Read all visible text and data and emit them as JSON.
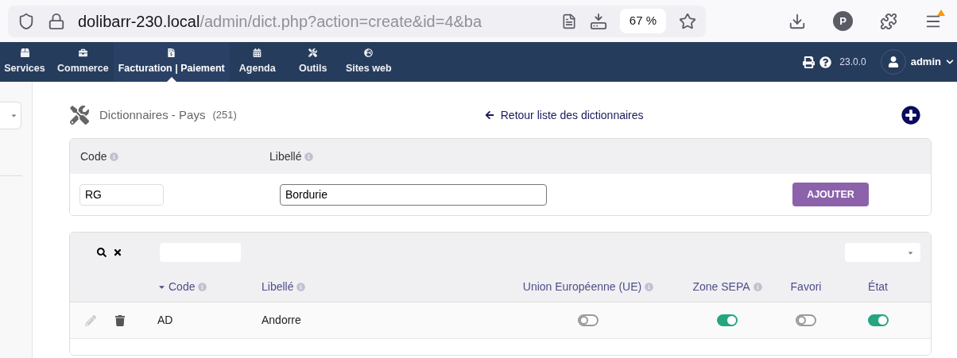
{
  "browser": {
    "url_host": "dolibarr-230.local",
    "url_path": "/admin/dict.php?action=create&id=4&ba",
    "zoom": "67 %",
    "profile": "P"
  },
  "top_menu": {
    "items": [
      {
        "label": "Services",
        "selected": false
      },
      {
        "label": "Commerce",
        "selected": false
      },
      {
        "label": "Facturation | Paiement",
        "selected": true
      },
      {
        "label": "Agenda",
        "selected": false
      },
      {
        "label": "Outils",
        "selected": false
      },
      {
        "label": "Sites web",
        "selected": false
      }
    ],
    "version": "23.0.0",
    "user": "admin"
  },
  "page": {
    "title": "Dictionnaires - Pays",
    "count": "(251)",
    "back_link": "Retour liste des dictionnaires"
  },
  "add_form": {
    "columns": [
      {
        "label": "Code",
        "info": true
      },
      {
        "label": "Libellé",
        "info": true
      }
    ],
    "code_value": "RG",
    "label_value": "Bordurie",
    "button": "AJOUTER"
  },
  "list": {
    "columns": [
      {
        "label": "Code",
        "info": true,
        "sorted": true
      },
      {
        "label": "Libellé",
        "info": true,
        "sorted": false
      },
      {
        "label": "Union Européenne (UE)",
        "info": true,
        "sorted": false
      },
      {
        "label": "Zone SEPA",
        "info": true,
        "sorted": false
      },
      {
        "label": "Favori",
        "info": false,
        "sorted": false
      },
      {
        "label": "État",
        "info": false,
        "sorted": false
      }
    ],
    "rows": [
      {
        "code": "AD",
        "label": "Andorre",
        "ue": false,
        "sepa": true,
        "favori": false,
        "etat": true
      }
    ]
  }
}
